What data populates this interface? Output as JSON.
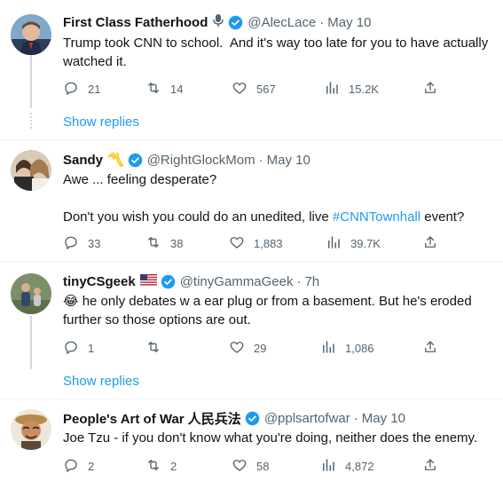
{
  "tweets": [
    {
      "name": "First Class Fatherhood",
      "has_mic": true,
      "handle": "@AlecLace",
      "date": "May 10",
      "lines": [
        "Trump took CNN to school.  And it's way too late for you to have actually",
        "watched it."
      ],
      "replies": "21",
      "retweets": "14",
      "likes": "567",
      "views": "15.2K"
    },
    {
      "name": "Sandy",
      "name_emoji": "〽️",
      "handle": "@RightGlockMom",
      "date": "May 10",
      "line1": "Awe ... feeling desperate?",
      "line2_pre": "Don't you wish you could do an unedited, live ",
      "hashtag": "#CNNTownhall",
      "line2_post": " event?",
      "replies": "33",
      "retweets": "38",
      "likes": "1,883",
      "views": "39.7K"
    },
    {
      "name": "tinyCSgeek",
      "handle": "@tinyGammaGeek",
      "date": "7h",
      "emoji": "😂",
      "line1": " he only debates w a ear plug or from a basement. But he's eroded",
      "line2": "further so those options are out.",
      "replies": "1",
      "retweets": "",
      "likes": "29",
      "views": "1,086"
    },
    {
      "name": "People's Art of War 人民兵法",
      "handle": "@pplsartofwar",
      "date": "May 10",
      "line1": "Joe Tzu - if you don't know what you're doing, neither does the enemy.",
      "replies": "2",
      "retweets": "2",
      "likes": "58",
      "views": "4,872"
    }
  ],
  "show_replies_label": "Show replies",
  "colors": {
    "accent": "#1d9bf0",
    "muted": "#536471",
    "text": "#0f1419"
  }
}
